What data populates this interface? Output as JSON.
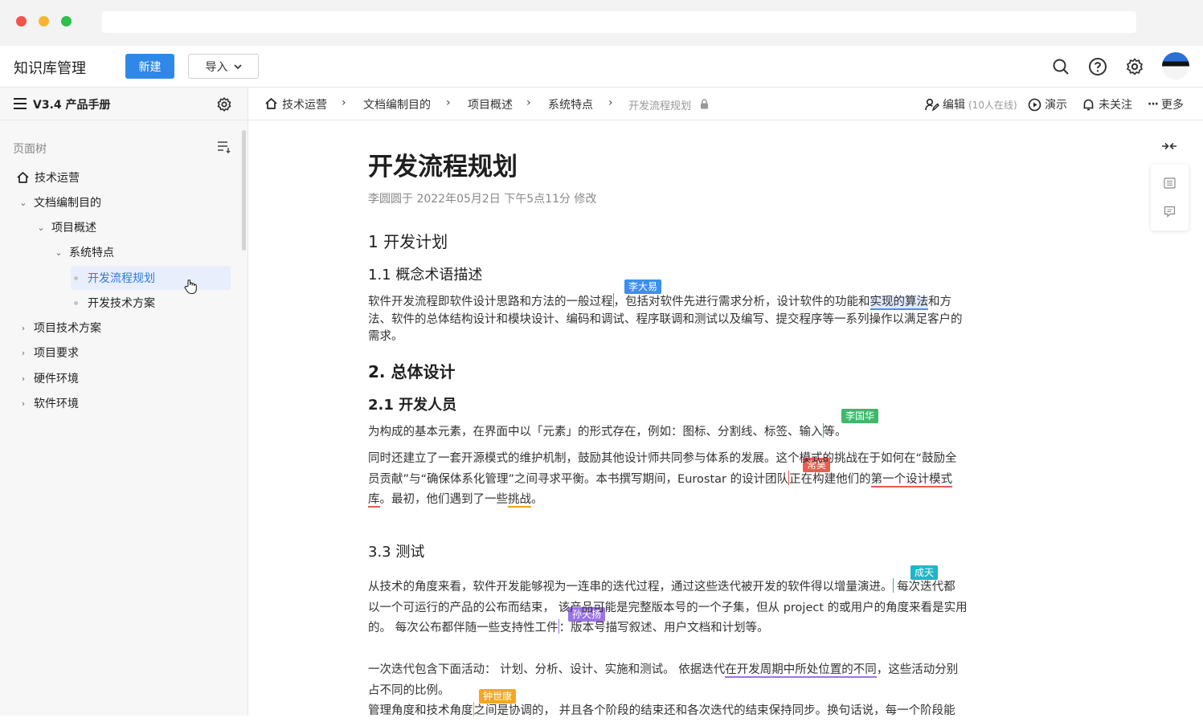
{
  "header": {
    "app_title": "知识库管理",
    "new_button": "新建",
    "import_button": "导入"
  },
  "sidebar": {
    "title": "V3.4 产品手册",
    "tree_label": "页面树",
    "items": [
      {
        "label": "技术运营"
      },
      {
        "label": "文档编制目的"
      },
      {
        "label": "项目概述"
      },
      {
        "label": "系统特点"
      },
      {
        "label": "开发流程规划"
      },
      {
        "label": "开发技术方案"
      },
      {
        "label": "项目技术方案"
      },
      {
        "label": "项目要求"
      },
      {
        "label": "硬件环境"
      },
      {
        "label": "软件环境"
      }
    ]
  },
  "breadcrumb": {
    "items": [
      "技术运营",
      "文档编制目的",
      "项目概述",
      "系统特点",
      "开发流程规划"
    ]
  },
  "toolbar": {
    "edit": "编辑",
    "online": "(10人在线)",
    "present": "演示",
    "follow": "未关注",
    "more": "更多"
  },
  "doc": {
    "title": "开发流程规划",
    "meta": "李圆圆于 2022年05月2日 下午5点11分 修改",
    "h_1": "1 开发计划",
    "h_1_1": "1.1 概念术语描述",
    "p1_l1a": "软件开发流程即软件设计思路和方法的一般过程",
    "p1_l1b": "，包括对软件先进行需求分析，设计软件的功能和",
    "p1_l1c": "实现的算法",
    "p1_l1d": "和方",
    "p1_l2": "法、软件的总体结构设计和模块设计、编码和调试、程序联调和测试以及编写、提交程序等一系列操作以满足客户的",
    "p1_l3": "需求。",
    "h_2": "2. 总体设计",
    "h_2_1": "2.1 开发人员",
    "p2a": "为构成的基本元素，在界面中以「元素」的形式存在，例如：图标、分割线、标签、输入",
    "p2b": "等。",
    "p3_l1a": "同时还建立了一套开源模式的维护机制，鼓励其他设计师共同参与体系的发展。这个模式的挑战在于如何在“鼓励全",
    "p3_l2a": "员贡献”与“确保体系化管理”之间寻求平衡。本书撰写期间，Eurostar 的设计团队",
    "p3_l2b": "正在构建他们的",
    "p3_l2c": "第一个设计模式",
    "p3_l3a": "库",
    "p3_l3b": "。最初，他们遇到了一些",
    "p3_l3c": "挑战",
    "p3_l3d": "。",
    "h_3_3": "3.3 测试",
    "p4_l1a": "从技术的角度来看，软件开发能够视为一连串的迭代过程，通过这些迭代被开发的软件得以增量演进。",
    "p4_l1b": " 每次迭代都",
    "p4_l2": "以一个可运行的产品的公布而结束，  该产品可能是完整版本号的一个子集，但从 project 的或用户的角度来看是实用",
    "p4_l3a": "的。 每次公布都伴随一些支持性工件",
    "p4_l3b": "：版本号描写叙述、用户文档和计划等。",
    "p5_l1a": "一次迭代包含下面活动： 计划、分析、设计、实施和测试。 依据迭代",
    "p5_l1b": "在开发周期中所处位置的不同",
    "p5_l1c": "，这些活动分别",
    "p5_l2": "占不同的比例。",
    "p5_l3a": "管理角度和技术角度",
    "p5_l3b": "之间是协调的， 并且各个阶段的结束还和各次迭代的结束保持同步。换句话说，每一个阶段能"
  },
  "collaborators": {
    "c1": {
      "name": "李大易",
      "color": "#3b8ff0"
    },
    "c2": {
      "name": "李国华",
      "color": "#3fb86a"
    },
    "c3": {
      "name": "常昊",
      "color": "#ef5b4f"
    },
    "c4": {
      "name": "成天",
      "color": "#1fb6c7"
    },
    "c5": {
      "name": "孙天扬",
      "color": "#9a73e6"
    },
    "c6": {
      "name": "钟世康",
      "color": "#f5a623"
    }
  }
}
